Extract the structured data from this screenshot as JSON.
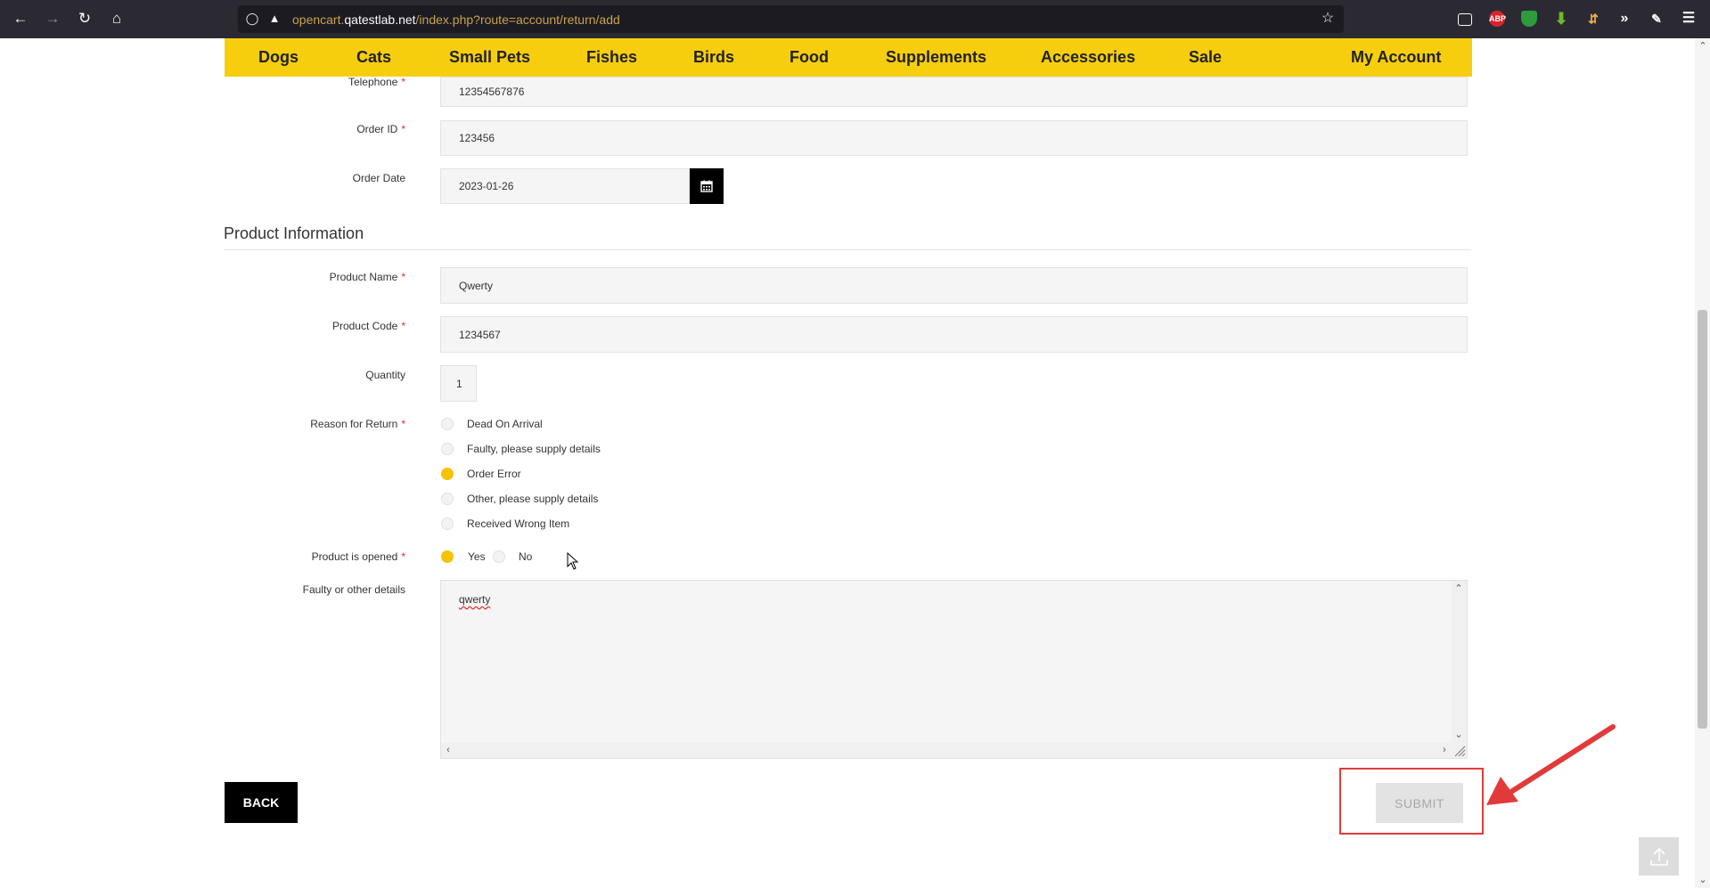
{
  "browser": {
    "url_host": "opencart.qatestlab.net",
    "url_prefix": "opencart.",
    "url_host_name": "qatestlab.net",
    "url_path": "/index.php?route=account/return/add",
    "extensions": [
      {
        "name": "pocket",
        "label": ""
      },
      {
        "name": "adblock",
        "label": "ABP",
        "color": "#d8232a"
      },
      {
        "name": "shield",
        "label": "",
        "color": "#2e9b3d"
      },
      {
        "name": "download",
        "label": "",
        "color": "#6eb82c"
      }
    ]
  },
  "nav": {
    "items": [
      "Dogs",
      "Cats",
      "Small Pets",
      "Fishes",
      "Birds",
      "Food",
      "Supplements",
      "Accessories",
      "Sale",
      "My Account"
    ]
  },
  "form": {
    "telephone": {
      "label": "Telephone",
      "value": "12354567876"
    },
    "order_id": {
      "label": "Order ID",
      "value": "123456"
    },
    "order_date": {
      "label": "Order Date",
      "value": "2023-01-26"
    },
    "section_title": "Product Information",
    "product_name": {
      "label": "Product Name",
      "value": "Qwerty"
    },
    "product_code": {
      "label": "Product Code",
      "value": "1234567"
    },
    "quantity": {
      "label": "Quantity",
      "value": "1"
    },
    "reason": {
      "label": "Reason for Return",
      "options": [
        "Dead On Arrival",
        "Faulty, please supply details",
        "Order Error",
        "Other, please supply details",
        "Received Wrong Item"
      ],
      "selected": "Order Error"
    },
    "opened": {
      "label": "Product is opened",
      "options": [
        "Yes",
        "No"
      ],
      "selected": "Yes"
    },
    "details": {
      "label": "Faulty or other details",
      "value": "qwerty"
    },
    "required_mark": "*"
  },
  "buttons": {
    "back": "BACK",
    "submit": "SUBMIT"
  },
  "colors": {
    "accent": "#f7ce0e",
    "annotation": "#e23a3a"
  }
}
